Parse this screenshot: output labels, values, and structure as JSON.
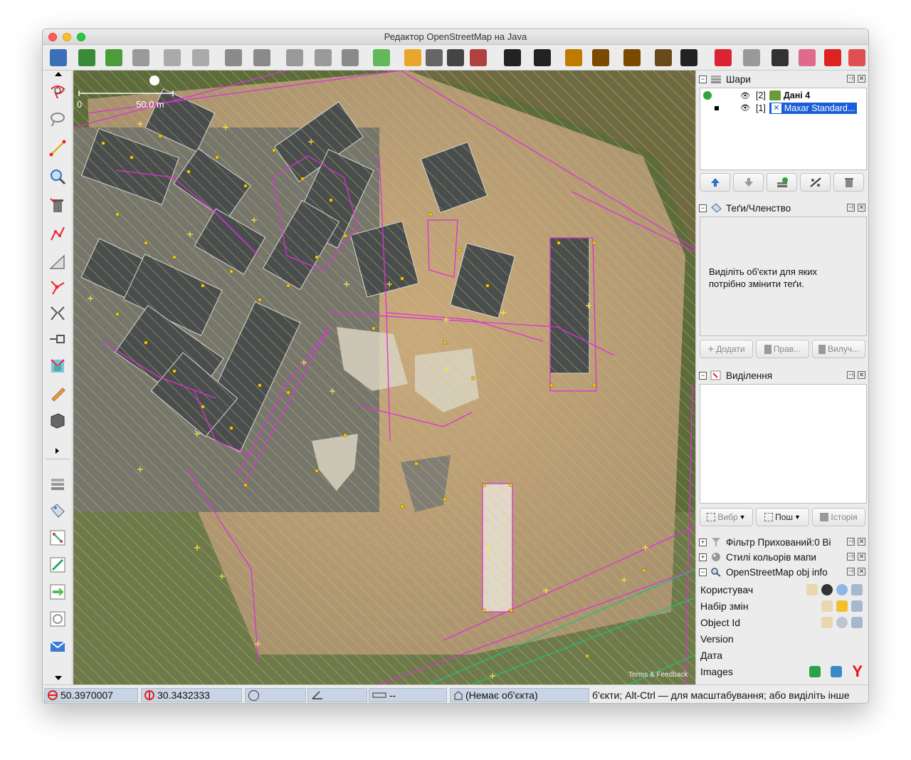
{
  "window": {
    "title": "Редактор OpenStreetMap на Java"
  },
  "toolbar": {
    "buttons": [
      "open-icon",
      "download-icon",
      "upload-icon",
      "upload-disabled-icon",
      "undo-icon",
      "redo-icon",
      "preferences-icon",
      "layer-info-icon",
      "simplify-icon",
      "split-icon",
      "refresh-icon",
      "validate-icon",
      "highway-preset-icon",
      "barrier-preset-icon",
      "traffic-light-icon",
      "wall-preset-icon",
      "car-icon",
      "bus-icon",
      "poi-icon",
      "food-icon",
      "castle-icon",
      "industrial-icon",
      "select-arrow-icon",
      "split-way-icon",
      "stone-icon",
      "rail-icon",
      "tag-icon",
      "no-entry-icon",
      "exit-icon"
    ]
  },
  "map": {
    "scale_zero": "0",
    "scale_label": "50.0 m",
    "attribution": "Terms & Feedback"
  },
  "layers_panel": {
    "title": "Шари",
    "layers": [
      {
        "index": "[2]",
        "name": "Дані 4",
        "active": true
      },
      {
        "index": "[1]",
        "name": "Maxar Standard...",
        "selected": true
      }
    ]
  },
  "tags_panel": {
    "title": "Теґи/Членство",
    "hint": "Виділіть об'єкти для яких потрібно змінити теґи.",
    "add_label": "Додати",
    "edit_label": "Прав...",
    "delete_label": "Вилуч..."
  },
  "selection_panel": {
    "title": "Виділення",
    "select_label": "Вибр",
    "search_label": "Пош",
    "history_label": "Історія"
  },
  "filter_panel": {
    "title": "Фільтр Прихований:0 Ві"
  },
  "styles_panel": {
    "title": "Стилі кольорів мапи"
  },
  "objinfo_panel": {
    "title": "OpenStreetMap obj info",
    "rows": [
      "Користувач",
      "Набір змін",
      "Object Id",
      "Version",
      "Дата",
      "Images"
    ]
  },
  "status": {
    "lat": "50.3970007",
    "lon": "30.3432333",
    "length": "--",
    "object": "(Немає об'єкта)",
    "message": "б'єкти; Alt-Ctrl — для масштабування; або виділіть інше"
  }
}
